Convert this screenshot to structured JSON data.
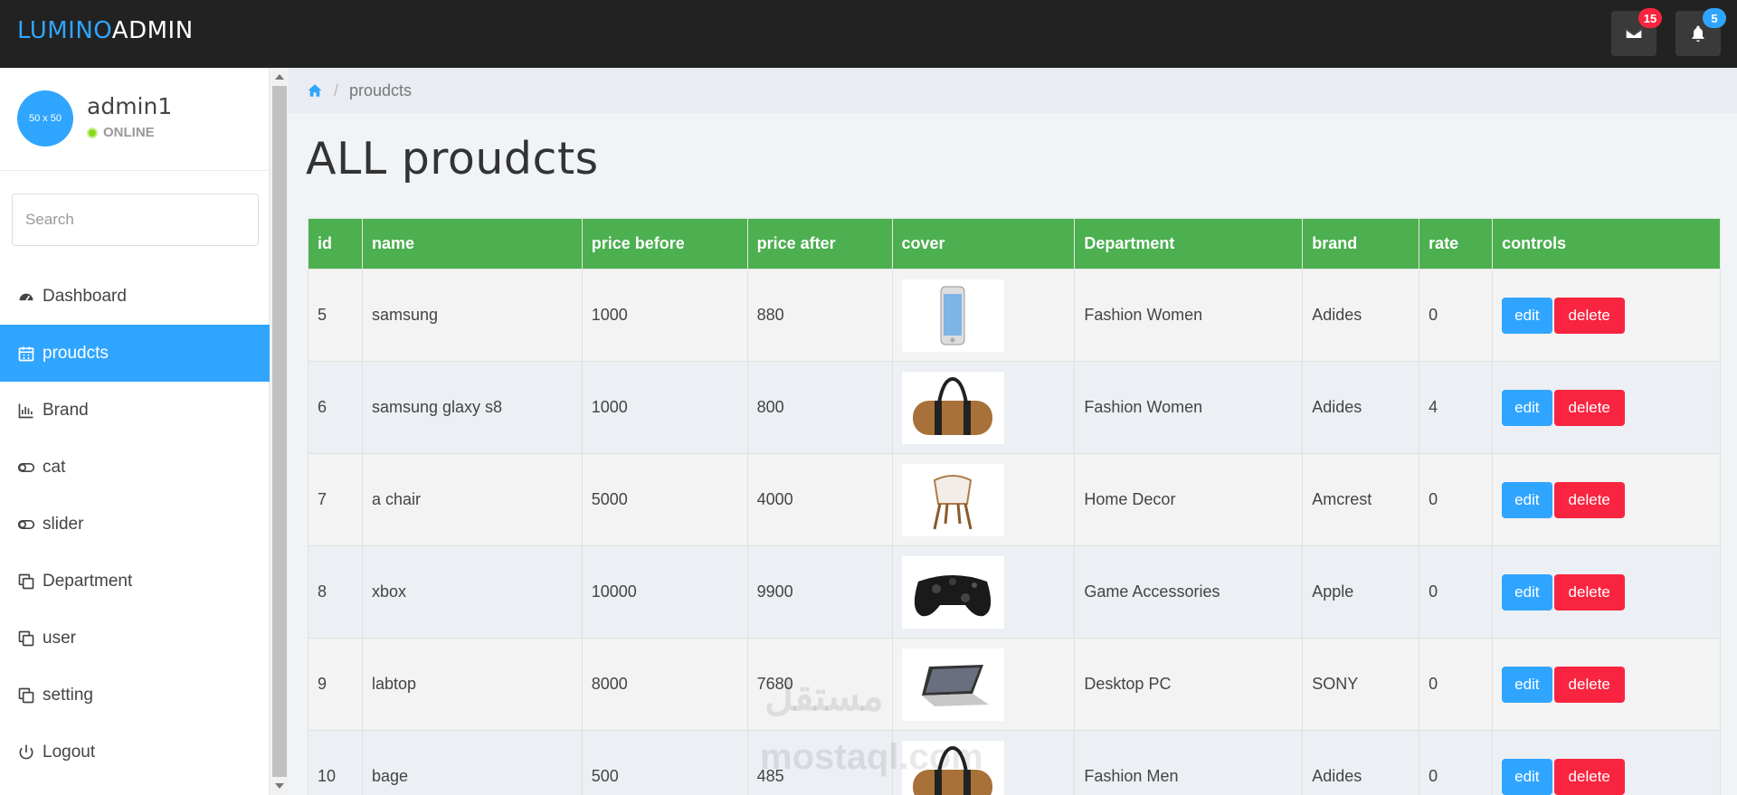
{
  "header": {
    "brand_part1": "LUMINO",
    "brand_part2": "ADMIN",
    "messages_count": "15",
    "notifications_count": "5",
    "accent_color": "#30a5ff"
  },
  "profile": {
    "avatar_text": "50 x 50",
    "name": "admin1",
    "status": "ONLINE"
  },
  "search": {
    "placeholder": "Search"
  },
  "menu": [
    {
      "label": "Dashboard",
      "icon": "dashboard-icon",
      "active": false
    },
    {
      "label": "proudcts",
      "icon": "calendar-icon",
      "active": true
    },
    {
      "label": "Brand",
      "icon": "bar-chart-icon",
      "active": false
    },
    {
      "label": "cat",
      "icon": "toggle-icon",
      "active": false
    },
    {
      "label": "slider",
      "icon": "toggle-icon",
      "active": false
    },
    {
      "label": "Department",
      "icon": "copy-icon",
      "active": false
    },
    {
      "label": "user",
      "icon": "copy-icon",
      "active": false
    },
    {
      "label": "setting",
      "icon": "copy-icon",
      "active": false
    },
    {
      "label": "Logout",
      "icon": "power-icon",
      "active": false
    }
  ],
  "breadcrumb": {
    "current": "proudcts"
  },
  "page_title": "ALL proudcts",
  "table": {
    "headers": [
      "id",
      "name",
      "price before",
      "price after",
      "cover",
      "Department",
      "brand",
      "rate",
      "controls"
    ],
    "header_color": "#4caf50",
    "rows": [
      {
        "id": "5",
        "name": "samsung",
        "price_before": "1000",
        "price_after": "880",
        "cover": "phone",
        "department": "Fashion Women",
        "brand": "Adides",
        "rate": "0"
      },
      {
        "id": "6",
        "name": "samsung glaxy s8",
        "price_before": "1000",
        "price_after": "800",
        "cover": "bag",
        "department": "Fashion Women",
        "brand": "Adides",
        "rate": "4"
      },
      {
        "id": "7",
        "name": "a chair",
        "price_before": "5000",
        "price_after": "4000",
        "cover": "chair",
        "department": "Home Decor",
        "brand": "Amcrest",
        "rate": "0"
      },
      {
        "id": "8",
        "name": "xbox",
        "price_before": "10000",
        "price_after": "9900",
        "cover": "controller",
        "department": "Game Accessories",
        "brand": "Apple",
        "rate": "0"
      },
      {
        "id": "9",
        "name": "labtop",
        "price_before": "8000",
        "price_after": "7680",
        "cover": "laptop",
        "department": "Desktop PC",
        "brand": "SONY",
        "rate": "0"
      },
      {
        "id": "10",
        "name": "bage",
        "price_before": "500",
        "price_after": "485",
        "cover": "bag",
        "department": "Fashion Men",
        "brand": "Adides",
        "rate": "0"
      }
    ],
    "edit_label": "edit",
    "delete_label": "delete"
  },
  "watermark": {
    "line1": "مستقل",
    "line2": "mostaql.com"
  }
}
